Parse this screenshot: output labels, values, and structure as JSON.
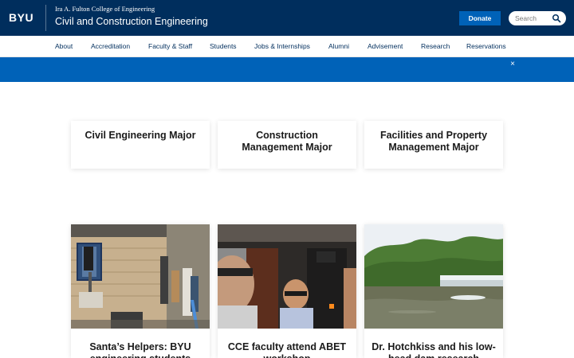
{
  "header": {
    "logo": "BYU",
    "college": "Ira A. Fulton College of Engineering",
    "department": "Civil and Construction Engineering",
    "donate_label": "Donate",
    "search_placeholder": "Search"
  },
  "nav": {
    "items": [
      "About",
      "Accreditation",
      "Faculty & Staff",
      "Students",
      "Jobs & Internships",
      "Alumni",
      "Advisement",
      "Research",
      "Reservations"
    ]
  },
  "alert": {
    "close_label": "×"
  },
  "majors": [
    {
      "title": "Civil Engineering Major"
    },
    {
      "title": "Construction Management Major"
    },
    {
      "title": "Facilities and Property Management Major"
    }
  ],
  "news": [
    {
      "title": "Santa’s Helpers: BYU engineering students"
    },
    {
      "title": "CCE faculty attend ABET workshop"
    },
    {
      "title": "Dr. Hotchkiss and his low-head dam research"
    }
  ],
  "colors": {
    "primary": "#002e5d",
    "accent": "#0062b8"
  }
}
